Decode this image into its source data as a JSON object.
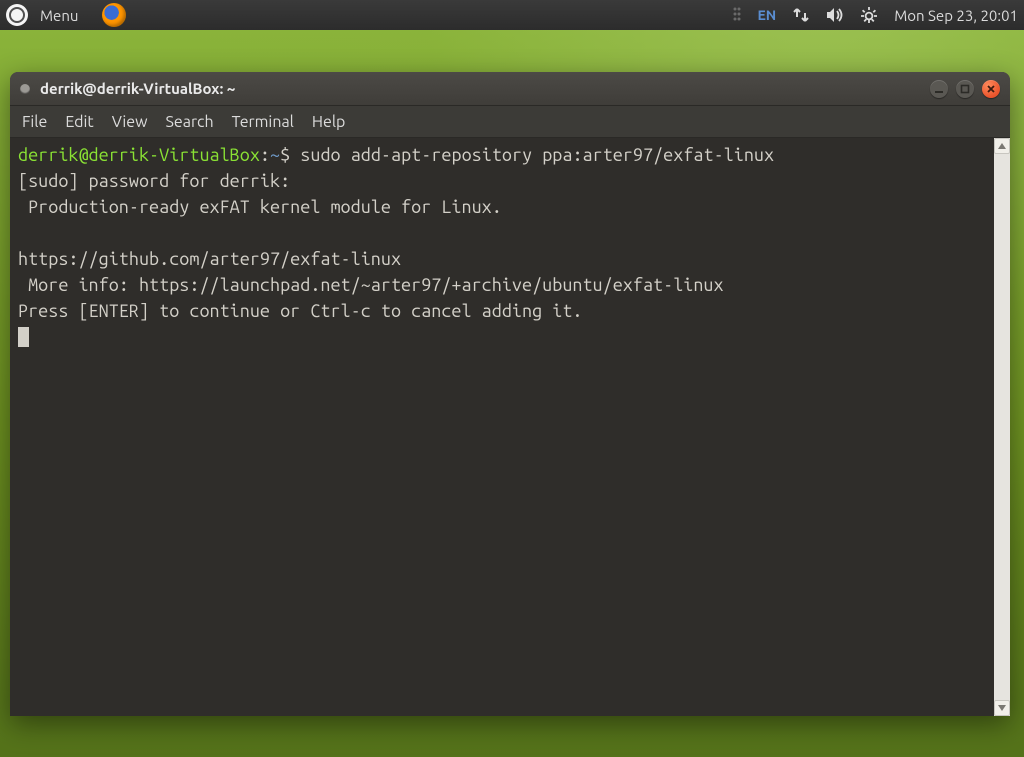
{
  "panel": {
    "menu_label": "Menu",
    "lang": "EN",
    "datetime": "Mon Sep 23, 20:01"
  },
  "window": {
    "title": "derrik@derrik-VirtualBox: ~",
    "menus": {
      "file": "File",
      "edit": "Edit",
      "view": "View",
      "search": "Search",
      "terminal": "Terminal",
      "help": "Help"
    }
  },
  "terminal": {
    "prompt_userhost": "derrik@derrik-VirtualBox",
    "prompt_sep": ":",
    "prompt_path": "~",
    "prompt_symbol": "$",
    "command": "sudo add-apt-repository ppa:arter97/exfat-linux",
    "lines": {
      "l1": "[sudo] password for derrik:",
      "l2": " Production-ready exFAT kernel module for Linux.",
      "l3": "",
      "l4": "https://github.com/arter97/exfat-linux",
      "l5": " More info: https://launchpad.net/~arter97/+archive/ubuntu/exfat-linux",
      "l6": "Press [ENTER] to continue or Ctrl-c to cancel adding it."
    }
  }
}
